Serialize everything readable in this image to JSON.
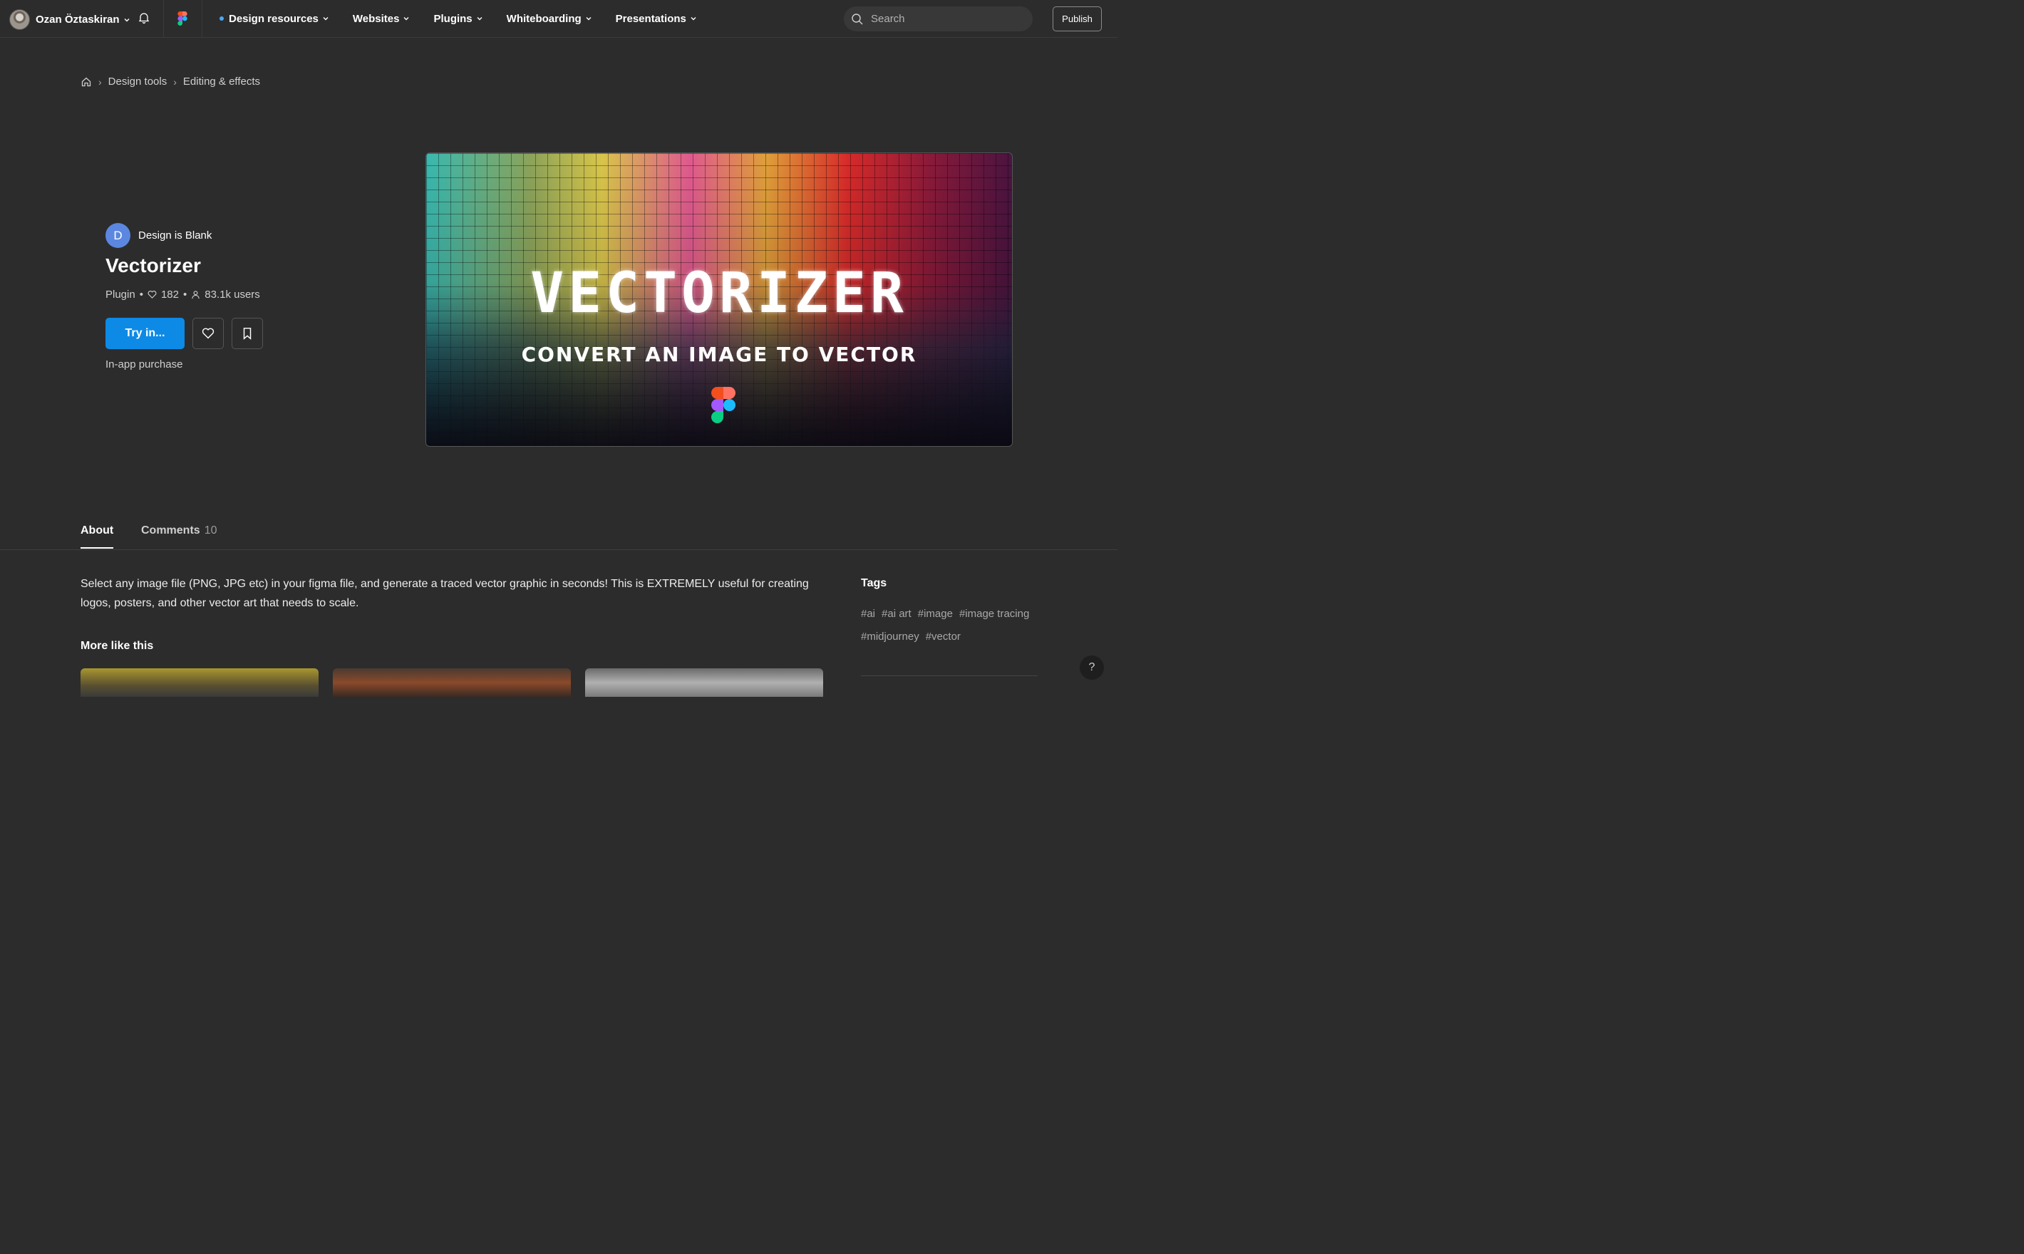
{
  "user": {
    "name": "Ozan Öztaskiran"
  },
  "nav": {
    "items": [
      {
        "label": "Design resources",
        "active": true
      },
      {
        "label": "Websites"
      },
      {
        "label": "Plugins"
      },
      {
        "label": "Whiteboarding"
      },
      {
        "label": "Presentations"
      }
    ],
    "search_placeholder": "Search",
    "publish_label": "Publish"
  },
  "breadcrumb": [
    "Design tools",
    "Editing & effects"
  ],
  "plugin": {
    "author_initial": "D",
    "author": "Design is Blank",
    "title": "Vectorizer",
    "type": "Plugin",
    "likes": "182",
    "users": "83.1k users",
    "try_label": "Try in...",
    "purchase_note": "In-app purchase"
  },
  "hero": {
    "title": "VECTORIZER",
    "subtitle": "CONVERT AN IMAGE TO VECTOR"
  },
  "tabs": {
    "about": "About",
    "comments": "Comments",
    "comments_count": "10"
  },
  "description": "Select any image file (PNG, JPG etc) in your figma file, and generate a traced vector graphic in seconds! This is EXTREMELY useful for creating logos, posters, and other vector art that needs to scale.",
  "more_title": "More like this",
  "tags_title": "Tags",
  "tags": [
    "#ai",
    "#ai art",
    "#image",
    "#image tracing",
    "#midjourney",
    "#vector"
  ],
  "help_label": "?",
  "colors": {
    "accent": "#0d8ae6",
    "background": "#2c2c2c"
  }
}
